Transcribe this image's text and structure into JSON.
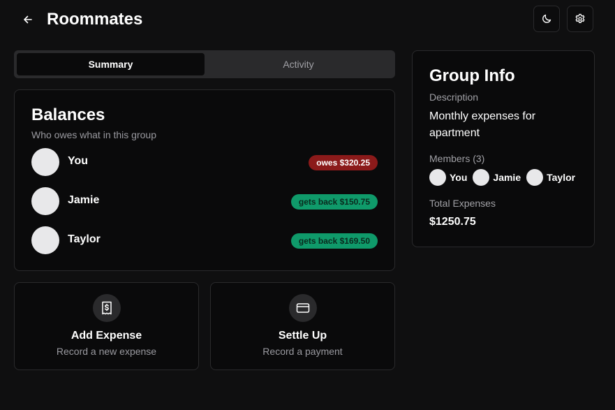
{
  "header": {
    "title": "Roommates",
    "back_icon": "arrow-left-icon",
    "theme_icon": "moon-icon",
    "settings_icon": "gear-icon"
  },
  "tabs": [
    {
      "label": "Summary",
      "active": true
    },
    {
      "label": "Activity",
      "active": false
    }
  ],
  "balances": {
    "title": "Balances",
    "subtitle": "Who owes what in this group",
    "members": [
      {
        "name": "You",
        "status": "owes $320.25",
        "type": "owes"
      },
      {
        "name": "Jamie",
        "status": "gets back $150.75",
        "type": "gets_back"
      },
      {
        "name": "Taylor",
        "status": "gets back $169.50",
        "type": "gets_back"
      }
    ]
  },
  "actions": {
    "add_expense": {
      "title": "Add Expense",
      "subtitle": "Record a new expense",
      "icon": "receipt-dollar-icon"
    },
    "settle_up": {
      "title": "Settle Up",
      "subtitle": "Record a payment",
      "icon": "credit-card-icon"
    }
  },
  "group_info": {
    "title": "Group Info",
    "description_label": "Description",
    "description": "Monthly expenses for apartment",
    "members_label": "Members (3)",
    "members": [
      "You",
      "Jamie",
      "Taylor"
    ],
    "total_label": "Total Expenses",
    "total": "$1250.75"
  },
  "colors": {
    "background": "#0f0f10",
    "card": "#0a0a0b",
    "border": "#2a2a2c",
    "owes_badge": "#8b1a1a",
    "gets_back_badge": "#0f9a6a"
  }
}
